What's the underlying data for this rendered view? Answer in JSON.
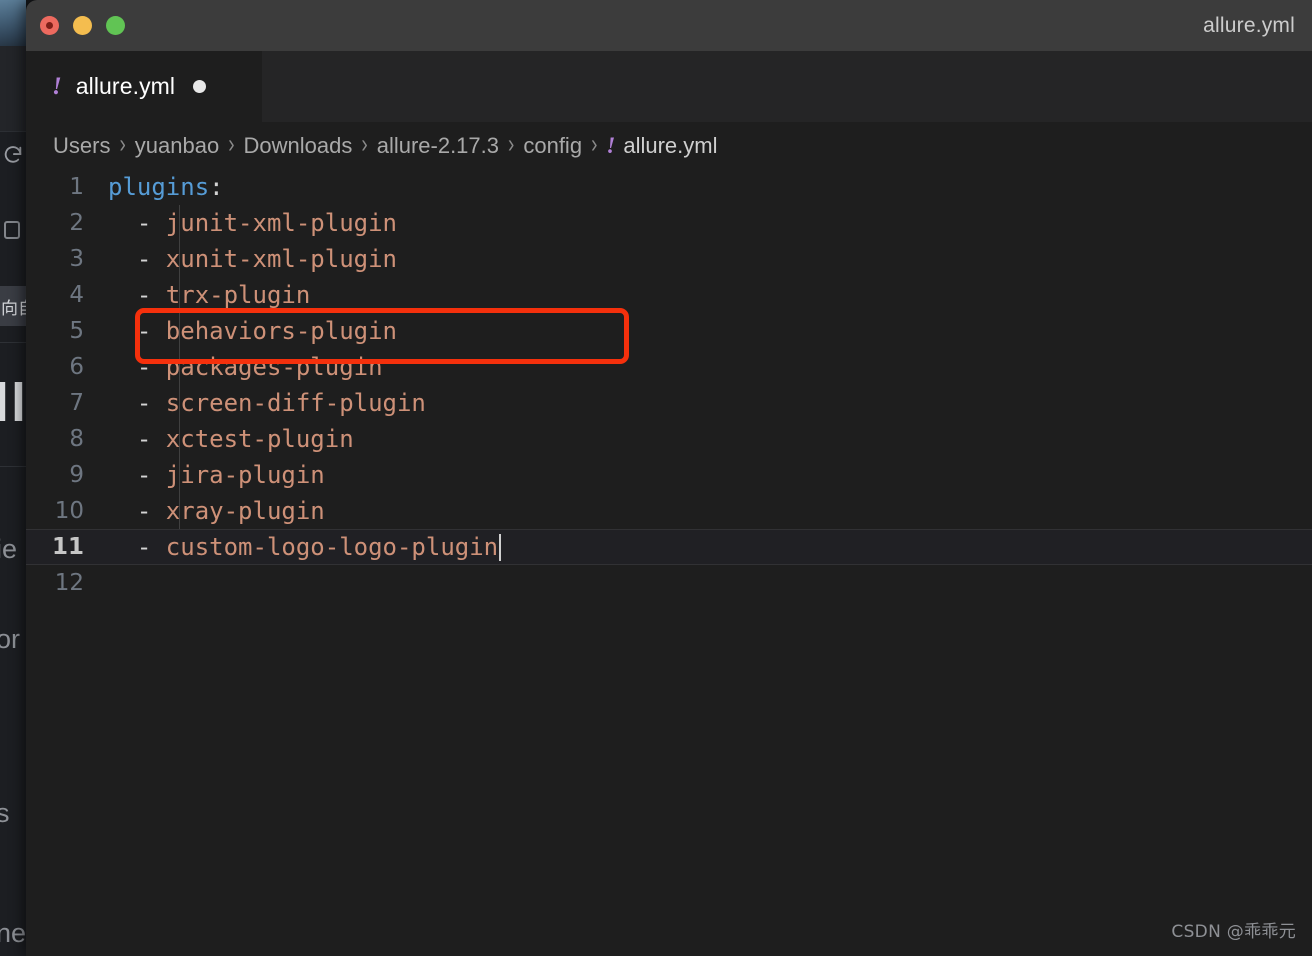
{
  "window": {
    "title": "allure.yml",
    "traffic_lights": [
      "close-button",
      "minimize-button",
      "zoom-button"
    ]
  },
  "tab": {
    "icon": "yaml-file-icon",
    "icon_glyph": "!",
    "label": "allure.yml",
    "dirty_indicator": "unsaved-changes-dot"
  },
  "breadcrumb": {
    "separator": "›",
    "items": [
      {
        "label": "Users"
      },
      {
        "label": "yuanbao"
      },
      {
        "label": "Downloads"
      },
      {
        "label": "allure-2.17.3"
      },
      {
        "label": "config"
      }
    ],
    "file_icon_glyph": "!",
    "file": "allure.yml"
  },
  "editor": {
    "language": "yaml",
    "active_line": 11,
    "lines": [
      {
        "num": "1",
        "key": "plugins",
        "punct": ":",
        "dash": "",
        "value": ""
      },
      {
        "num": "2",
        "key": "",
        "punct": "",
        "dash": "  - ",
        "value": "junit-xml-plugin"
      },
      {
        "num": "3",
        "key": "",
        "punct": "",
        "dash": "  - ",
        "value": "xunit-xml-plugin"
      },
      {
        "num": "4",
        "key": "",
        "punct": "",
        "dash": "  - ",
        "value": "trx-plugin"
      },
      {
        "num": "5",
        "key": "",
        "punct": "",
        "dash": "  - ",
        "value": "behaviors-plugin"
      },
      {
        "num": "6",
        "key": "",
        "punct": "",
        "dash": "  - ",
        "value": "packages-plugin"
      },
      {
        "num": "7",
        "key": "",
        "punct": "",
        "dash": "  - ",
        "value": "screen-diff-plugin"
      },
      {
        "num": "8",
        "key": "",
        "punct": "",
        "dash": "  - ",
        "value": "xctest-plugin"
      },
      {
        "num": "9",
        "key": "",
        "punct": "",
        "dash": "  - ",
        "value": "jira-plugin"
      },
      {
        "num": "10",
        "key": "",
        "punct": "",
        "dash": "  - ",
        "value": "xray-plugin"
      },
      {
        "num": "11",
        "key": "",
        "punct": "",
        "dash": "  - ",
        "value": "custom-logo-logo-plugin"
      },
      {
        "num": "12",
        "key": "",
        "punct": "",
        "dash": "",
        "value": ""
      }
    ]
  },
  "annotation": {
    "type": "red-highlight-rectangle",
    "target_line": "11",
    "color": "#f5300c"
  },
  "background_window": {
    "highlighted_row_text": "向自",
    "big_text_fragment": "ll l",
    "fragments": [
      "ie",
      "or",
      ";",
      "s",
      "ne"
    ],
    "icons": [
      "refresh-icon",
      "rounded-square-icon"
    ]
  },
  "watermark": {
    "text": "CSDN @乖乖元"
  },
  "colors": {
    "titlebar": "#3c3c3c",
    "tabbar": "#252526",
    "editor_bg": "#1e1e1e",
    "key": "#569cd6",
    "string": "#ce9178",
    "line_number": "#6e7681",
    "annotation": "#f5300c",
    "yaml_icon": "#b180d7"
  }
}
